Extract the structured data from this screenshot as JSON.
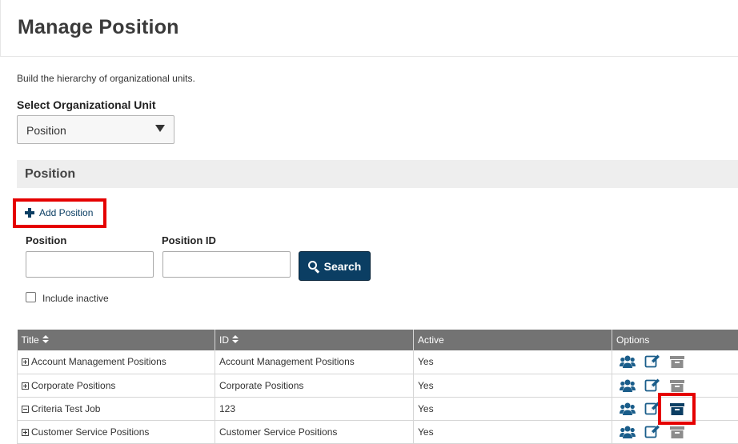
{
  "page": {
    "title": "Manage Position",
    "description": "Build the hierarchy of organizational units."
  },
  "org_unit": {
    "label": "Select Organizational Unit",
    "selected": "Position"
  },
  "section": {
    "title": "Position"
  },
  "add_button": {
    "label": "Add Position"
  },
  "filters": {
    "position_label": "Position",
    "position_value": "",
    "position_id_label": "Position ID",
    "position_id_value": "",
    "search_label": "Search",
    "include_inactive_label": "Include inactive",
    "include_inactive_checked": false
  },
  "table": {
    "headers": {
      "title": "Title",
      "id": "ID",
      "active": "Active",
      "options": "Options"
    },
    "rows": [
      {
        "title": "Account Management Positions",
        "id": "Account Management Positions",
        "active": "Yes",
        "expanded": false,
        "archive_active": false
      },
      {
        "title": "Corporate Positions",
        "id": "Corporate Positions",
        "active": "Yes",
        "expanded": false,
        "archive_active": false
      },
      {
        "title": "Criteria Test Job",
        "id": "123",
        "active": "Yes",
        "expanded": true,
        "archive_active": true
      },
      {
        "title": "Customer Service Positions",
        "id": "Customer Service Positions",
        "active": "Yes",
        "expanded": false,
        "archive_active": false
      }
    ]
  },
  "icons": {
    "users": "users-icon",
    "edit": "edit-icon",
    "archive": "archive-icon"
  },
  "colors": {
    "primary": "#0b3e63",
    "highlight": "#e50000",
    "table_header": "#737373",
    "icon_teal": "#1a5d8a",
    "archive_muted": "#8c8c8c"
  }
}
